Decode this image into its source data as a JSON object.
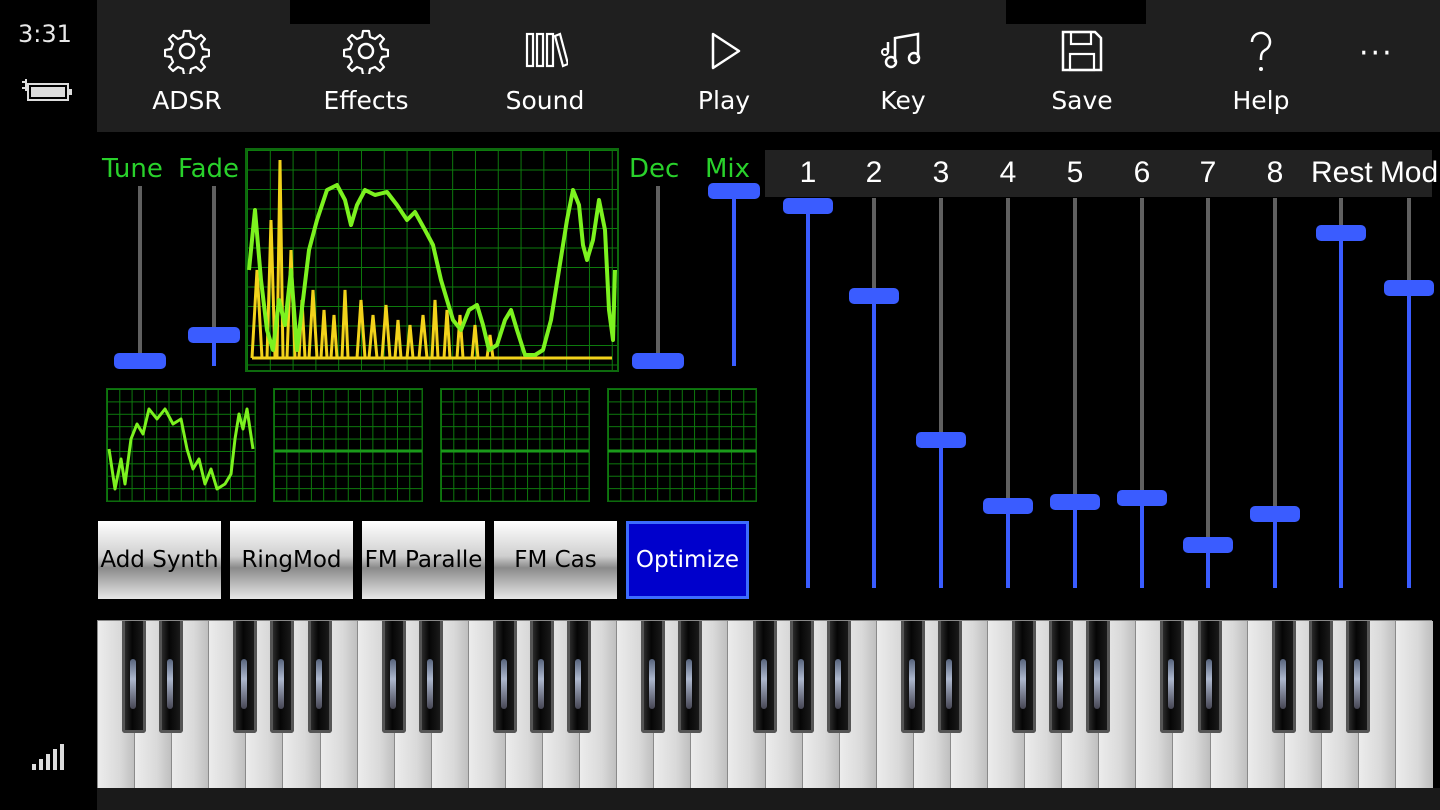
{
  "status": {
    "time": "3:31"
  },
  "commands": [
    {
      "label": "ADSR",
      "icon": "gear-icon"
    },
    {
      "label": "Effects",
      "icon": "gear-icon"
    },
    {
      "label": "Sound",
      "icon": "library-icon"
    },
    {
      "label": "Play",
      "icon": "play-icon"
    },
    {
      "label": "Key",
      "icon": "music-note-icon"
    },
    {
      "label": "Save",
      "icon": "save-icon"
    },
    {
      "label": "Help",
      "icon": "help-icon"
    }
  ],
  "more_label": "···",
  "sliders": {
    "tune": {
      "label": "Tune",
      "level": 0.03
    },
    "fade": {
      "label": "Fade",
      "level": 0.17
    },
    "dec": {
      "label": "Dec",
      "level": 0.03
    },
    "mix": {
      "label": "Mix",
      "level": 0.97
    }
  },
  "mode_buttons": [
    "Add Synth",
    "RingMod",
    "FM Paralle",
    "FM Cas",
    "Optimize"
  ],
  "active_mode": "Optimize",
  "harmonics": {
    "labels": [
      "1",
      "2",
      "3",
      "4",
      "5",
      "6",
      "7",
      "8",
      "Rest",
      "Mod"
    ],
    "levels": [
      0.98,
      0.75,
      0.38,
      0.21,
      0.22,
      0.23,
      0.11,
      0.19,
      0.91,
      0.77
    ]
  },
  "colors": {
    "accent": "#3a5cff",
    "scope_green": "#29d12b",
    "wave_yellow": "#f2d21b",
    "active_button": "#0000cc"
  }
}
